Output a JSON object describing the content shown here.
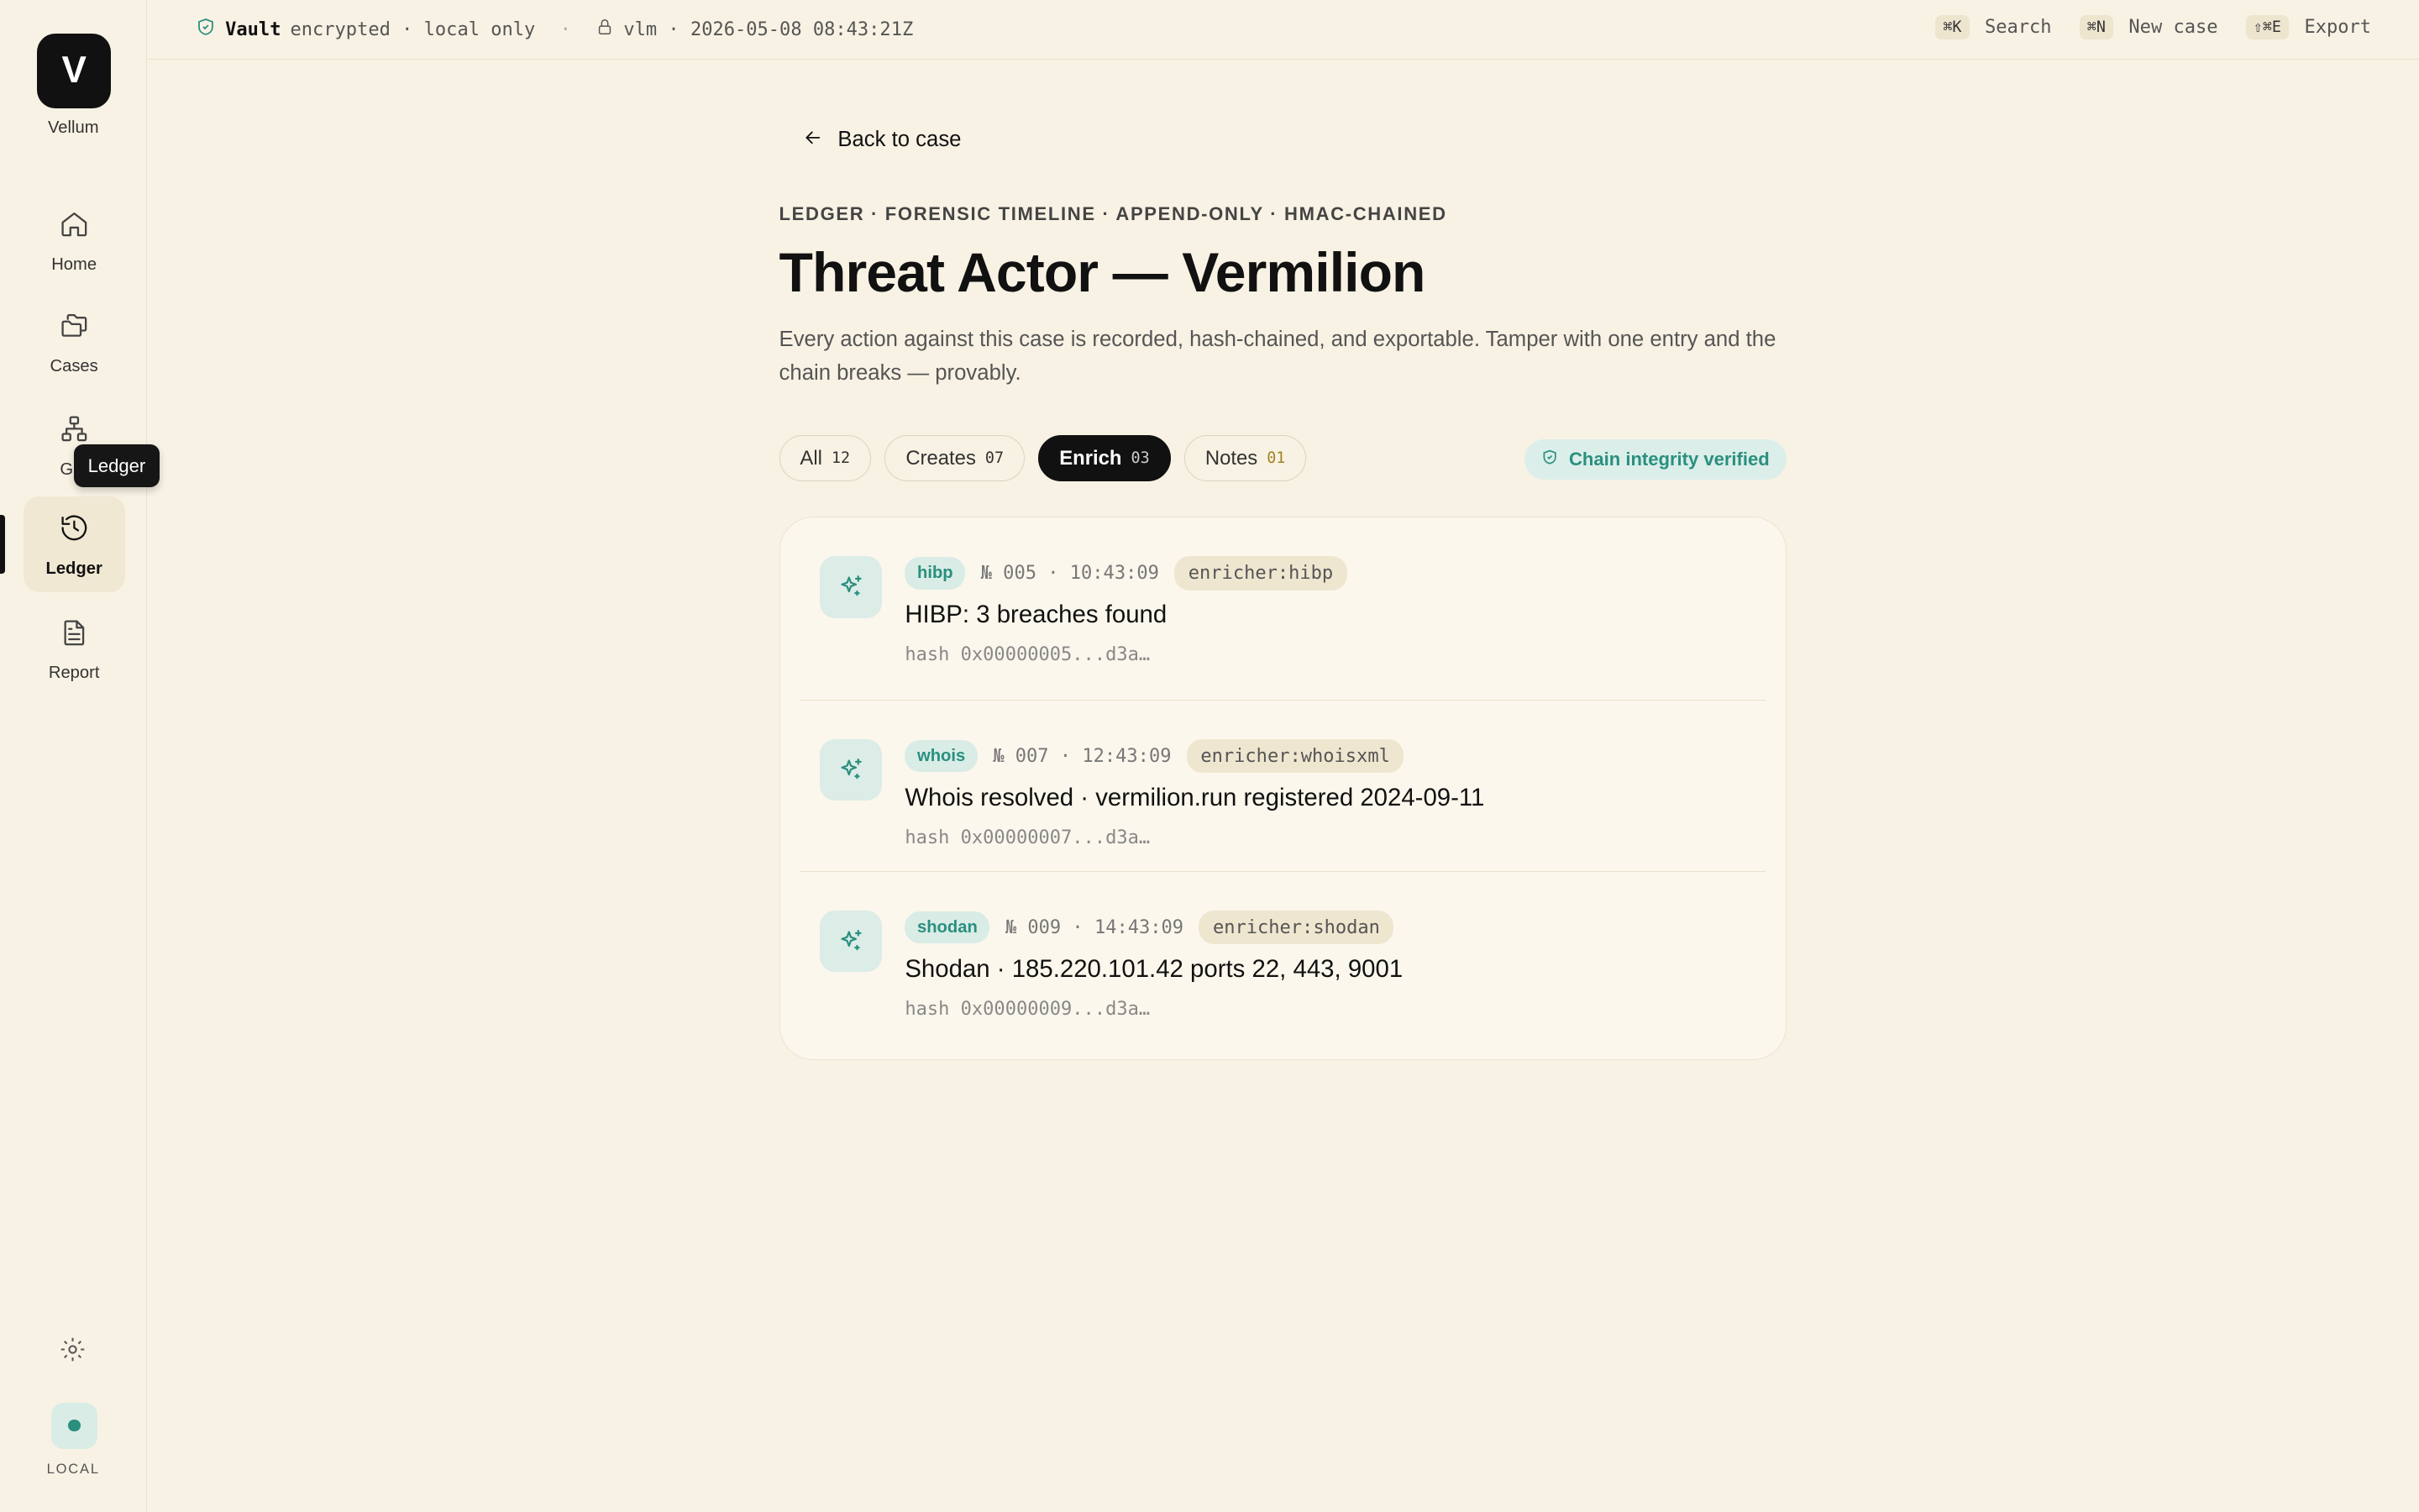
{
  "app": {
    "logo_letter": "V",
    "name": "Vellum"
  },
  "sidebar": {
    "items": [
      {
        "label": "Home",
        "icon": "home-icon"
      },
      {
        "label": "Cases",
        "icon": "folders-icon"
      },
      {
        "label": "Gra",
        "icon": "graph-icon"
      },
      {
        "label": "Ledger",
        "icon": "history-icon",
        "active": true
      },
      {
        "label": "Report",
        "icon": "file-text-icon"
      }
    ],
    "tooltip": "Ledger",
    "footer_label": "LOCAL"
  },
  "topbar": {
    "vault_label": "Vault",
    "vault_status": "encrypted · local only",
    "separator": "·",
    "session": "vlm · 2026-05-08 08:43:21Z",
    "actions": [
      {
        "kbd": "⌘K",
        "label": "Search"
      },
      {
        "kbd": "⌘N",
        "label": "New case"
      },
      {
        "kbd": "⇧⌘E",
        "label": "Export"
      }
    ]
  },
  "page": {
    "back_label": "Back to case",
    "eyebrow": "LEDGER · FORENSIC TIMELINE · APPEND-ONLY · HMAC-CHAINED",
    "title": "Threat Actor — Vermilion",
    "description": "Every action against this case is recorded, hash-chained, and exportable. Tamper with one entry and the chain breaks — provably.",
    "filters": [
      {
        "label": "All",
        "count": "12"
      },
      {
        "label": "Creates",
        "count": "07"
      },
      {
        "label": "Enrich",
        "count": "03",
        "active": true
      },
      {
        "label": "Notes",
        "count": "01"
      }
    ],
    "integrity_label": "Chain integrity verified"
  },
  "entries": [
    {
      "source": "hibp",
      "seq": "№ 005 · 10:43:09",
      "actor": "enricher:hibp",
      "title": "HIBP: 3 breaches found",
      "hash": "hash 0x00000005...d3a…"
    },
    {
      "source": "whois",
      "seq": "№ 007 · 12:43:09",
      "actor": "enricher:whoisxml",
      "title": "Whois resolved · vermilion.run registered 2024-09-11",
      "hash": "hash 0x00000007...d3a…"
    },
    {
      "source": "shodan",
      "seq": "№ 009 · 14:43:09",
      "actor": "enricher:shodan",
      "title": "Shodan · 185.220.101.42 ports 22, 443, 9001",
      "hash": "hash 0x00000009...d3a…"
    }
  ],
  "colors": {
    "accent": "#2a8f7f",
    "background": "#f8f2e4",
    "ink": "#111111",
    "gold": "#a08322"
  }
}
